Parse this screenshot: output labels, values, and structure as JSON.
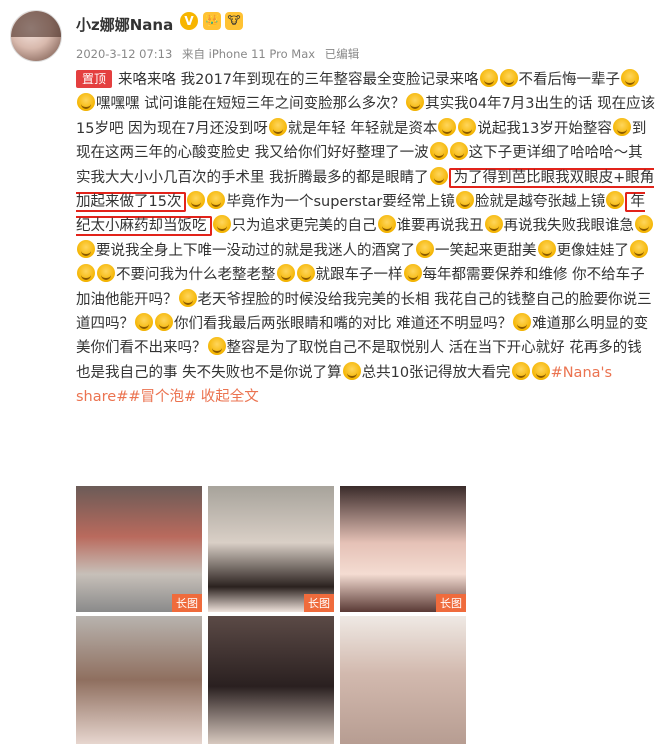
{
  "user": {
    "name": "小z娜娜Nana",
    "verified_badge": "V"
  },
  "meta": {
    "timestamp": "2020-3-12 07:13",
    "source": "来自 iPhone 11 Pro Max",
    "edited": "已编辑"
  },
  "post": {
    "pin_label": "置顶",
    "segments": [
      "来咯来咯 我2017年到现在的三年整容最全变脸记录来咯",
      "不看后悔一辈子",
      "嘿嘿嘿 试问谁能在短短三年之间变脸那么多次？",
      "其实我04年7月3出生的话 现在应该15岁吧 因为现在7月还没到呀",
      "就是年轻 年轻就是资本",
      "说起我13岁开始整容",
      "到现在这两三年的心酸变脸史 我又给你们好好整理了一波",
      "这下子更详细了哈哈哈～其实我大大小小几百次的手术里 我折腾最多的都是眼睛了",
      "为了得到芭比眼我双眼皮+眼角加起来做了15次",
      "毕竟作为一个superstar要经常上镜",
      "脸就是越夸张越上镜",
      "年纪太小麻药却当饭吃",
      "只为追求更完美的自己",
      "谁要再说我丑",
      "再说我失败我眼谁急",
      "要说我全身上下唯一没动过的就是我迷人的酒窝了",
      "一笑起来更甜美",
      "更像娃娃了",
      "不要问我为什么老整老整",
      "就跟车子一样",
      "每年都需要保养和维修 你不给车子加油他能开吗？",
      "老天爷捏脸的时候没给我完美的长相 我花自己的钱整自己的脸要你说三道四吗？",
      "你们看我最后两张眼睛和嘴的对比 难道还不明显吗？",
      "难道那么明显的变美你们看不出来吗？",
      "整容是为了取悦自己不是取悦别人 活在当下开心就好 花再多的钱也是我自己的事 失不失败也不是你说了算",
      "总共10张记得放大看完",
      "#Nana's share##冒个泡#",
      "收起全文"
    ]
  },
  "gallery": {
    "tag_label": "长图",
    "images": [
      {
        "type": "long"
      },
      {
        "type": "long"
      },
      {
        "type": "long"
      },
      {
        "type": "photo"
      },
      {
        "type": "photo"
      },
      {
        "type": "photo"
      }
    ]
  }
}
